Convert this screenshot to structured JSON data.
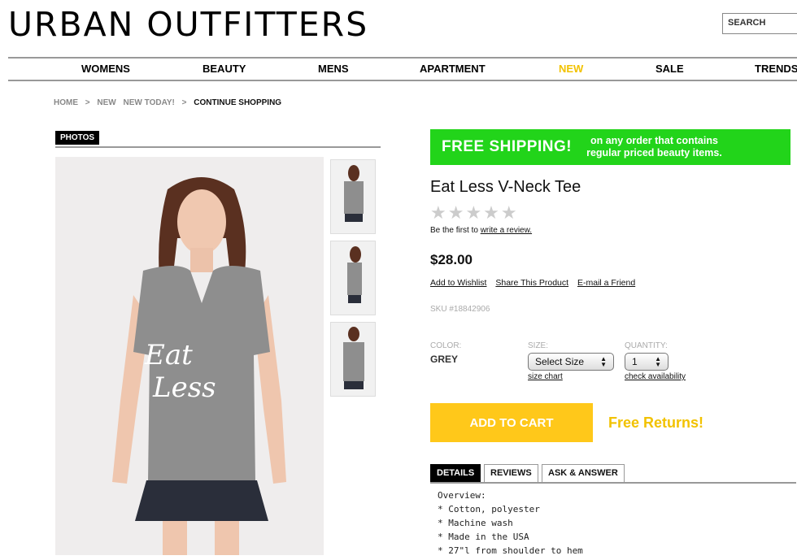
{
  "header": {
    "logo": "URBAN OUTFITTERS",
    "search_placeholder": "SEARCH"
  },
  "nav": {
    "items": [
      {
        "label": "WOMENS"
      },
      {
        "label": "BEAUTY"
      },
      {
        "label": "MENS"
      },
      {
        "label": "APARTMENT"
      },
      {
        "label": "NEW",
        "color": "#f2c200"
      },
      {
        "label": "SALE"
      },
      {
        "label": "TRENDS"
      }
    ]
  },
  "breadcrumb": {
    "items": [
      "HOME",
      ">",
      "NEW",
      "NEW TODAY!",
      ">",
      "CONTINUE SHOPPING"
    ]
  },
  "photos": {
    "tab_label": "PHOTOS",
    "main_shirt_text": "Eat Less"
  },
  "promo": {
    "title": "FREE SHIPPING!",
    "subtitle_line1": "on any order that contains",
    "subtitle_line2": "regular priced beauty items.",
    "color": "#22d41a"
  },
  "product": {
    "title": "Eat Less V-Neck Tee",
    "stars": "★★★★★",
    "review_prefix": "Be the first to",
    "review_link": "write a review.",
    "price": "$28.00",
    "links": [
      "Add to Wishlist",
      "Share This Product",
      "E-mail a Friend"
    ],
    "sku": "SKU #18842906"
  },
  "options": {
    "color_label": "COLOR:",
    "color_value": "GREY",
    "size_label": "SIZE:",
    "size_selected": "Select Size",
    "size_chart": "size chart",
    "quantity_label": "QUANTITY:",
    "quantity_selected": "1",
    "check_availability": "check availability"
  },
  "actions": {
    "add_to_cart": "ADD TO CART",
    "add_to_cart_color": "#ffc81a",
    "free_returns": "Free Returns!"
  },
  "tabs": {
    "items": [
      "DETAILS",
      "REVIEWS",
      "ASK & ANSWER"
    ],
    "active": "DETAILS"
  },
  "details": {
    "heading": "Overview:",
    "bullets": [
      "* Cotton, polyester",
      "* Machine wash",
      "* Made in the USA",
      "* 27\"l from shoulder to hem"
    ]
  }
}
